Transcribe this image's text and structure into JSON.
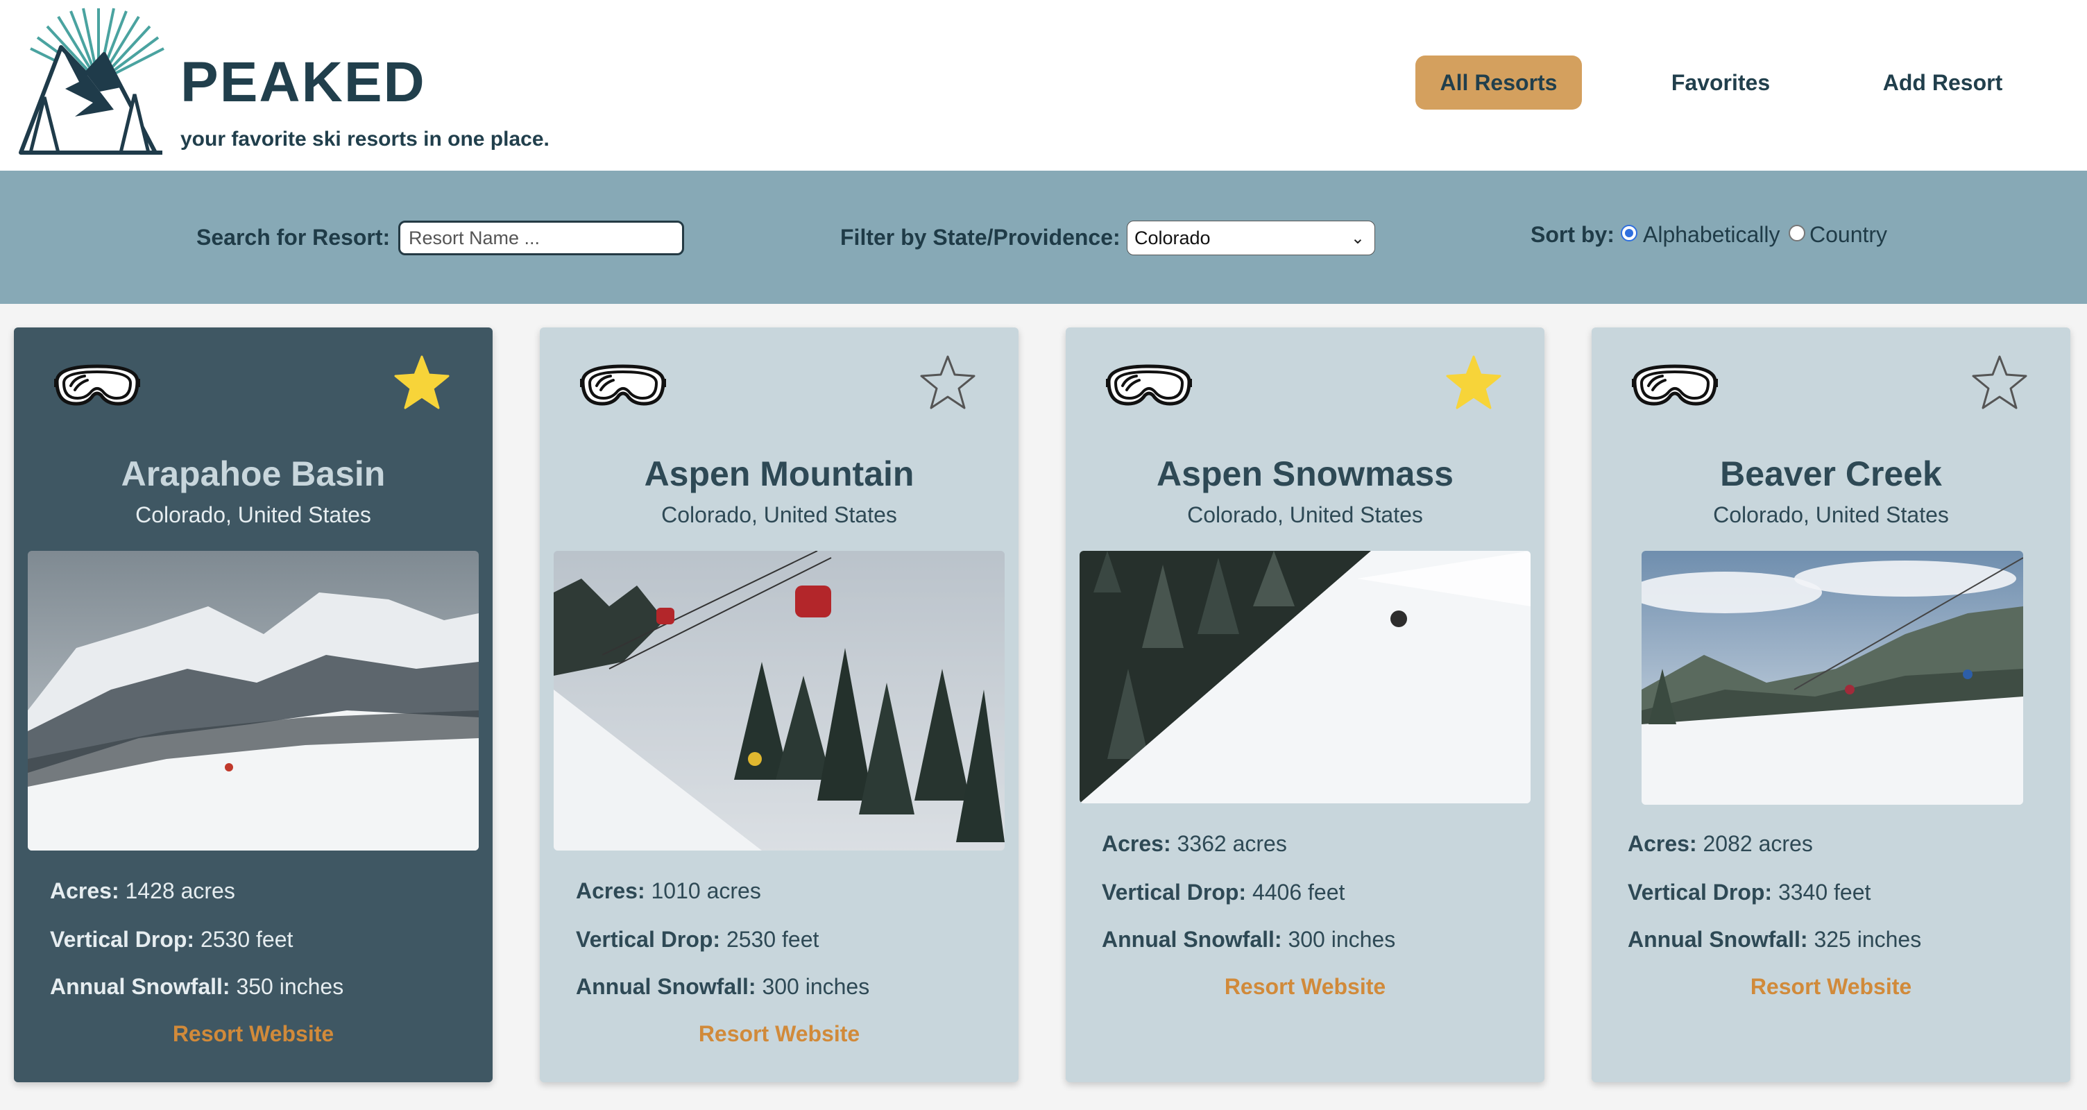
{
  "brand": {
    "title": "PEAKED",
    "tagline": "your favorite ski resorts in one place."
  },
  "nav": {
    "all_resorts": "All Resorts",
    "favorites": "Favorites",
    "add_resort": "Add Resort"
  },
  "filters": {
    "search_label": "Search for Resort:",
    "search_placeholder": "Resort Name ...",
    "search_value": "",
    "state_label": "Filter by State/Providence:",
    "state_selected": "Colorado",
    "sort_label": "Sort by:",
    "sort_options": [
      "Alphabetically",
      "Country"
    ],
    "sort_selected": "Alphabetically"
  },
  "labels": {
    "acres": "Acres:",
    "vertical": "Vertical Drop:",
    "snowfall": "Annual Snowfall:",
    "website": "Resort Website"
  },
  "colors": {
    "accent": "#d4a05e",
    "link": "#d18a3a",
    "filterbar": "#87a9b6",
    "card": "#c8d6dc",
    "card_selected": "#3f5763",
    "star_filled": "#f7d439"
  },
  "resorts": [
    {
      "name": "Arapahoe Basin",
      "location": "Colorado, United States",
      "acres": "1428 acres",
      "vertical": "2530 feet",
      "snowfall": "350 inches",
      "favorite": true
    },
    {
      "name": "Aspen Mountain",
      "location": "Colorado, United States",
      "acres": "1010 acres",
      "vertical": "2530 feet",
      "snowfall": "300 inches",
      "favorite": false
    },
    {
      "name": "Aspen Snowmass",
      "location": "Colorado, United States",
      "acres": "3362 acres",
      "vertical": "4406 feet",
      "snowfall": "300 inches",
      "favorite": true
    },
    {
      "name": "Beaver Creek",
      "location": "Colorado, United States",
      "acres": "2082 acres",
      "vertical": "3340 feet",
      "snowfall": "325 inches",
      "favorite": false
    }
  ]
}
